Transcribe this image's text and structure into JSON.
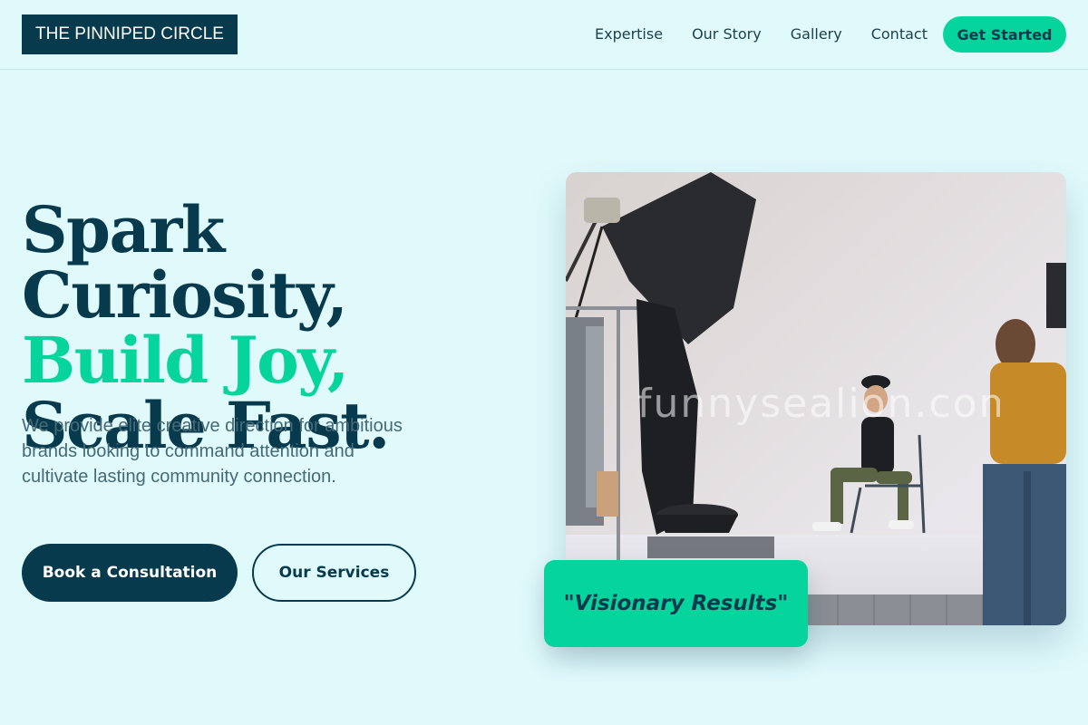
{
  "header": {
    "logo": "THE PINNIPED CIRCLE",
    "nav": [
      "Expertise",
      "Our Story",
      "Gallery",
      "Contact"
    ],
    "cta": "Get Started"
  },
  "hero": {
    "line1": "Spark Curiosity,",
    "line2": "Build Joy,",
    "line3": "Scale Fast.",
    "lead": "We provide elite creative direction for ambitious brands looking to command attention and cultivate lasting community connection.",
    "primary_button": "Book a Consultation",
    "secondary_button": "Our Services"
  },
  "image": {
    "watermark": "funnysealion.com"
  },
  "badge": {
    "text": "\"Visionary Results\""
  },
  "colors": {
    "background": "#e0fafc",
    "primary": "#083a4d",
    "accent": "#06d49d",
    "body_text": "#456a76"
  }
}
